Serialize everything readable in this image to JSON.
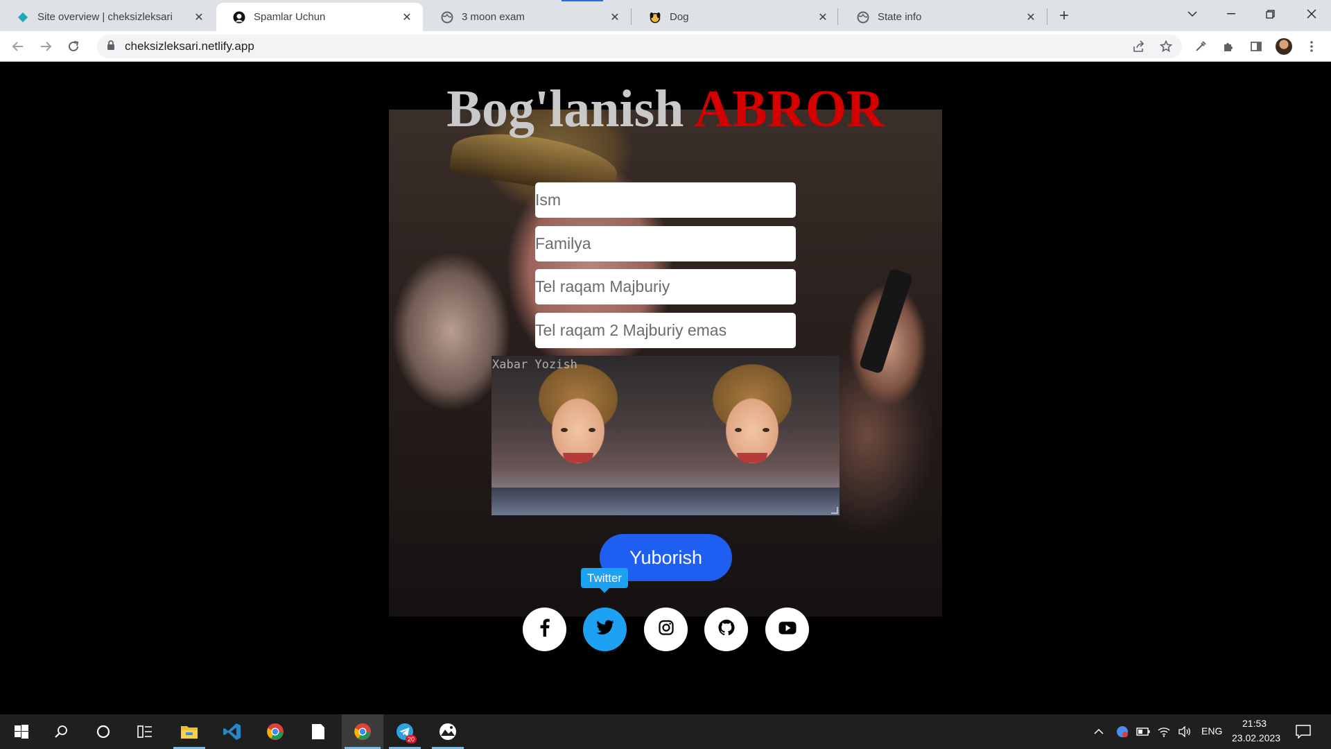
{
  "browser": {
    "tabs": [
      {
        "title": "Site overview | cheksizleksari",
        "icon": "netlify-icon",
        "active": false
      },
      {
        "title": "Spamlar Uchun",
        "icon": "github-icon",
        "active": true
      },
      {
        "title": "3 moon exam",
        "icon": "globe-icon",
        "active": false
      },
      {
        "title": "Dog",
        "icon": "dog-icon",
        "active": false
      },
      {
        "title": "State info",
        "icon": "globe-icon",
        "active": false
      }
    ],
    "url": "cheksizleksari.netlify.app"
  },
  "page": {
    "title_part1": "Bog'lanish",
    "title_part2": "ABROR",
    "title_part1_color": "#c9c9c9",
    "title_part2_color": "#d40000",
    "form": {
      "first_name_placeholder": "Ism",
      "last_name_placeholder": "Familya",
      "phone_placeholder": "Tel raqam Majburiy",
      "phone2_placeholder": "Tel raqam 2 Majburiy emas",
      "message_placeholder": "Xabar Yozish",
      "submit_label": "Yuborish",
      "submit_color": "#1e5ff2"
    },
    "tooltip": "Twitter",
    "social": [
      {
        "name": "facebook",
        "icon": "facebook-icon",
        "hovered": false
      },
      {
        "name": "twitter",
        "icon": "twitter-icon",
        "hovered": true
      },
      {
        "name": "instagram",
        "icon": "instagram-icon",
        "hovered": false
      },
      {
        "name": "github",
        "icon": "github-icon",
        "hovered": false
      },
      {
        "name": "youtube",
        "icon": "youtube-icon",
        "hovered": false
      }
    ],
    "twitter_color": "#1da1f2"
  },
  "taskbar": {
    "language": "ENG",
    "time": "21:53",
    "date": "23.02.2023",
    "telegram_badge": "20",
    "apps": [
      "start-icon",
      "search-icon",
      "cortana-icon",
      "task-view-icon",
      "file-explorer-icon",
      "vscode-icon",
      "chrome-icon",
      "notepad-icon",
      "chrome-active-icon",
      "telegram-icon",
      "photos-icon"
    ]
  }
}
